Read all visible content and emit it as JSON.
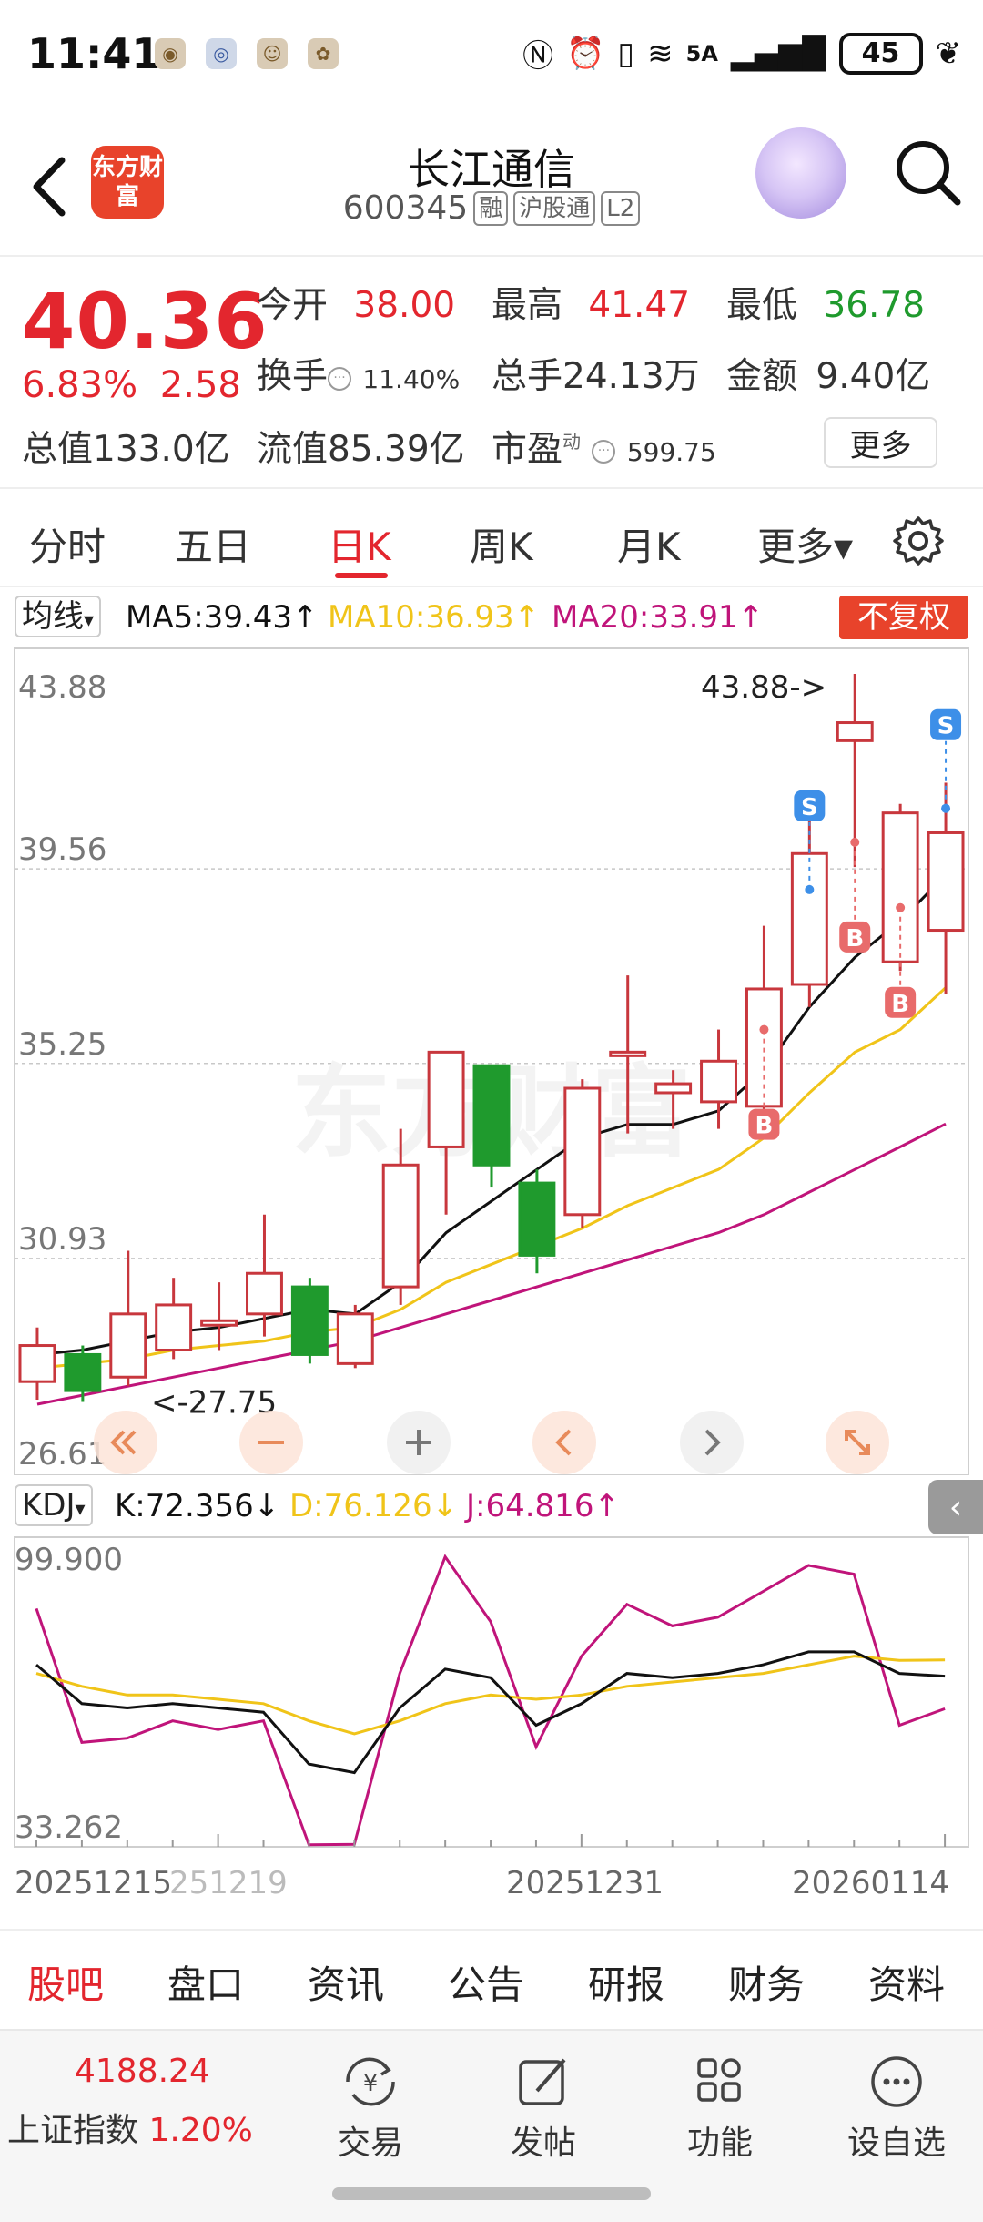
{
  "status_bar": {
    "time": "11:41",
    "network": "5A",
    "battery": "45"
  },
  "header": {
    "logo_text": "东方财富",
    "stock_name": "长江通信",
    "stock_code": "600345",
    "tags": [
      "融",
      "沪股通",
      "L2"
    ]
  },
  "quote": {
    "price": "40.36",
    "change_pct": "6.83%",
    "change_amt": "2.58",
    "open_label": "今开",
    "open": "38.00",
    "high_label": "最高",
    "high": "41.47",
    "low_label": "最低",
    "low": "36.78",
    "turnover_label": "换手",
    "turnover": "11.40%",
    "volume_label": "总手",
    "volume": "24.13万",
    "amount_label": "金额",
    "amount": "9.40亿",
    "mktcap_label": "总值",
    "mktcap": "133.0亿",
    "float_label": "流值",
    "float": "85.39亿",
    "pe_label": "市盈",
    "pe_sup": "动",
    "pe": "599.75",
    "more_label": "更多"
  },
  "tabs": [
    "分时",
    "五日",
    "日K",
    "周K",
    "月K",
    "更多▾"
  ],
  "active_tab": "日K",
  "ma_bar": {
    "selector": "均线",
    "ma5": "MA5:39.43↑",
    "ma10": "MA10:36.93↑",
    "ma20": "MA20:33.91↑",
    "fq": "不复权",
    "color_ma5": "#111111",
    "color_ma10": "#f0c419",
    "color_ma20": "#c0147a"
  },
  "price_chart": {
    "axis_labels": [
      "43.88",
      "39.56",
      "35.25",
      "30.93",
      "26.61"
    ],
    "high_annot": "43.88->",
    "low_annot": "<-27.75",
    "buy_mark": "B",
    "sell_mark": "S"
  },
  "kdj_bar": {
    "selector": "KDJ",
    "k": "K:72.356↓",
    "d": "D:76.126↓",
    "j": "J:64.816↑",
    "axis_top": "99.900",
    "axis_bottom": "33.262"
  },
  "dates": [
    "20251215",
    "251219",
    "20251231",
    "20260114"
  ],
  "chart_data": {
    "type": "candlestick",
    "yrange": [
      26.61,
      43.88
    ],
    "candles": [
      {
        "o": 28.2,
        "c": 29.0,
        "h": 29.4,
        "l": 27.8
      },
      {
        "o": 28.8,
        "c": 28.0,
        "h": 29.0,
        "l": 27.75
      },
      {
        "o": 28.3,
        "c": 29.7,
        "h": 31.1,
        "l": 28.1
      },
      {
        "o": 28.9,
        "c": 29.9,
        "h": 30.5,
        "l": 28.7
      },
      {
        "o": 29.45,
        "c": 29.55,
        "h": 30.4,
        "l": 28.9
      },
      {
        "o": 29.7,
        "c": 30.6,
        "h": 31.9,
        "l": 29.2
      },
      {
        "o": 30.3,
        "c": 28.8,
        "h": 30.5,
        "l": 28.6
      },
      {
        "o": 28.6,
        "c": 29.7,
        "h": 29.9,
        "l": 28.5
      },
      {
        "o": 30.3,
        "c": 33.0,
        "h": 33.8,
        "l": 29.9
      },
      {
        "o": 33.4,
        "c": 35.5,
        "h": 35.5,
        "l": 31.9
      },
      {
        "o": 35.2,
        "c": 33.0,
        "h": 35.2,
        "l": 32.5
      },
      {
        "o": 32.6,
        "c": 31.0,
        "h": 32.9,
        "l": 30.6
      },
      {
        "o": 31.9,
        "c": 34.7,
        "h": 34.9,
        "l": 31.6
      },
      {
        "o": 35.5,
        "c": 35.5,
        "h": 37.2,
        "l": 33.7
      },
      {
        "o": 34.6,
        "c": 34.8,
        "h": 35.1,
        "l": 33.8
      },
      {
        "o": 34.4,
        "c": 35.3,
        "h": 36.0,
        "l": 33.8
      },
      {
        "o": 34.3,
        "c": 36.9,
        "h": 38.3,
        "l": 34.2
      },
      {
        "o": 37.0,
        "c": 39.9,
        "h": 40.7,
        "l": 36.5
      },
      {
        "o": 42.4,
        "c": 42.8,
        "h": 43.88,
        "l": 39.6
      },
      {
        "o": 37.5,
        "c": 40.8,
        "h": 41.0,
        "l": 37.3
      },
      {
        "o": 38.2,
        "c": 40.36,
        "h": 41.47,
        "l": 36.78
      }
    ],
    "ma5": [
      28.8,
      28.9,
      29.1,
      29.3,
      29.4,
      29.6,
      29.8,
      29.7,
      30.4,
      31.5,
      32.2,
      32.9,
      33.6,
      33.9,
      33.9,
      34.2,
      35.1,
      36.5,
      37.6,
      38.4,
      39.43
    ],
    "ma10": [
      28.5,
      28.6,
      28.7,
      28.9,
      29.0,
      29.1,
      29.3,
      29.4,
      29.8,
      30.4,
      30.8,
      31.2,
      31.6,
      32.1,
      32.5,
      32.9,
      33.6,
      34.6,
      35.5,
      36.0,
      36.93
    ],
    "ma20": [
      27.7,
      27.9,
      28.1,
      28.3,
      28.5,
      28.7,
      28.9,
      29.1,
      29.4,
      29.7,
      30.0,
      30.3,
      30.6,
      30.9,
      31.2,
      31.5,
      31.9,
      32.4,
      32.9,
      33.4,
      33.91
    ],
    "kdj_range": [
      33.262,
      99.9
    ],
    "k": [
      75,
      66,
      65,
      66,
      65,
      64,
      52,
      50,
      65,
      74,
      72,
      61,
      66,
      73,
      72,
      73,
      75,
      78,
      78,
      73,
      72.356
    ],
    "d": [
      73,
      70,
      68,
      68,
      67,
      66,
      62,
      59,
      62,
      66,
      68,
      67,
      68,
      70,
      71,
      72,
      73,
      75,
      77,
      76,
      76.126
    ],
    "j": [
      88,
      57,
      58,
      62,
      60,
      62,
      33.3,
      33.4,
      73,
      100,
      85,
      56,
      77,
      89,
      84,
      86,
      92,
      98,
      96,
      61,
      64.816
    ]
  },
  "bottom_tabs": [
    "股吧",
    "盘口",
    "资讯",
    "公告",
    "研报",
    "财务",
    "资料"
  ],
  "toolbar": {
    "index_value": "4188.24",
    "index_name": "上证指数",
    "index_change": "1.20%",
    "items": [
      "交易",
      "发帖",
      "功能",
      "设自选"
    ]
  },
  "colors": {
    "up": "#e3262e",
    "down": "#1f9a2d",
    "accent": "#e8432b"
  }
}
